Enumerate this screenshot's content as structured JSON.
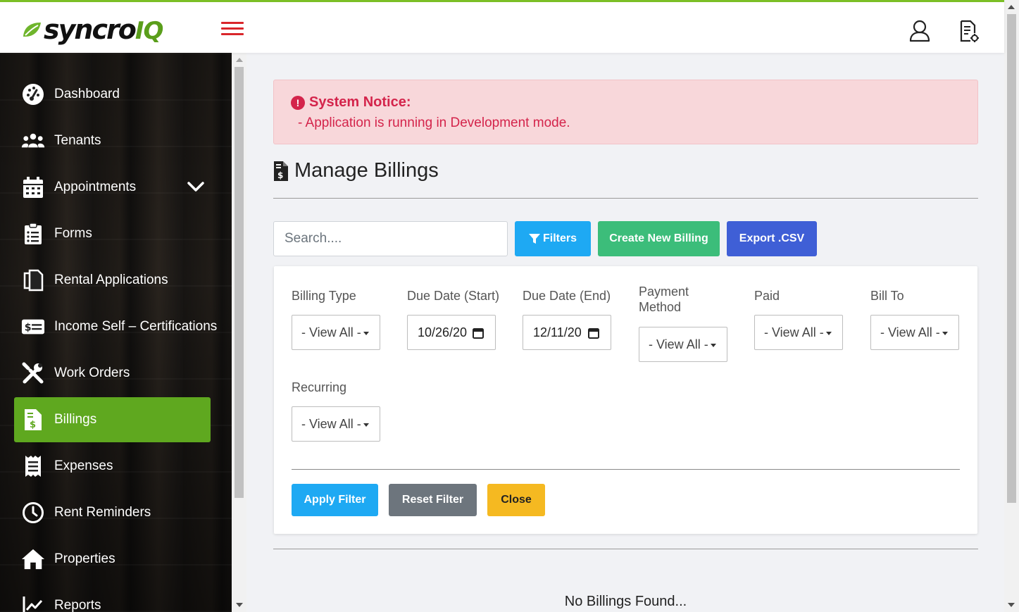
{
  "brand": {
    "name_part1": "syncro",
    "name_part2": "IQ",
    "accent": "#5fa81f"
  },
  "header": {
    "menu_icon": "hamburger-icon",
    "user_icon": "user-icon",
    "doc_icon": "document-icon"
  },
  "sidebar": {
    "items": [
      {
        "label": "Dashboard",
        "icon": "dashboard-icon"
      },
      {
        "label": "Tenants",
        "icon": "users-icon"
      },
      {
        "label": "Appointments",
        "icon": "calendar-icon",
        "expandable": true
      },
      {
        "label": "Forms",
        "icon": "clipboard-icon"
      },
      {
        "label": "Rental Applications",
        "icon": "copy-icon"
      },
      {
        "label": "Income Self – Certifications",
        "icon": "money-icon"
      },
      {
        "label": "Work Orders",
        "icon": "tools-icon"
      },
      {
        "label": "Billings",
        "icon": "invoice-icon",
        "active": true
      },
      {
        "label": "Expenses",
        "icon": "receipt-icon"
      },
      {
        "label": "Rent Reminders",
        "icon": "clock-icon"
      },
      {
        "label": "Properties",
        "icon": "home-icon"
      },
      {
        "label": "Reports",
        "icon": "chart-icon"
      }
    ]
  },
  "notice": {
    "title": "System Notice:",
    "message": "- Application is running in Development mode."
  },
  "page": {
    "title": "Manage Billings"
  },
  "toolbar": {
    "search_placeholder": "Search....",
    "filters_label": "Filters",
    "create_label": "Create New Billing",
    "export_label": "Export .CSV"
  },
  "filters": {
    "billing_type": {
      "label": "Billing Type",
      "value": "- View All -"
    },
    "due_start": {
      "label": "Due Date (Start)",
      "value": "10/26/20"
    },
    "due_end": {
      "label": "Due Date (End)",
      "value": "12/11/20"
    },
    "payment_method": {
      "label": "Payment Method",
      "value": "- View All -"
    },
    "paid": {
      "label": "Paid",
      "value": "- View All -"
    },
    "bill_to": {
      "label": "Bill To",
      "value": "- View All -"
    },
    "recurring": {
      "label": "Recurring",
      "value": "- View All -"
    },
    "apply_label": "Apply Filter",
    "reset_label": "Reset Filter",
    "close_label": "Close"
  },
  "results": {
    "empty_text": "No Billings Found..."
  }
}
